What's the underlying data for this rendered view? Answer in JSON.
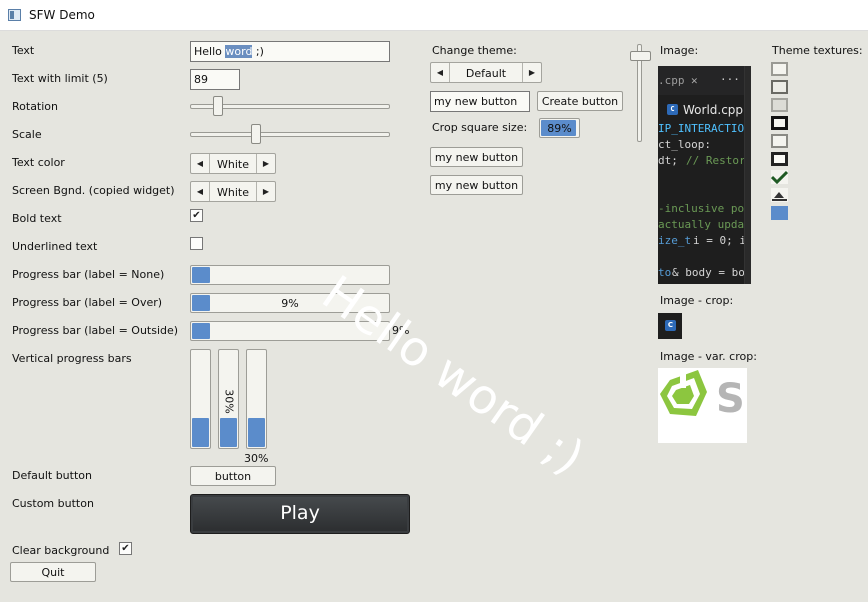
{
  "window": {
    "title": "SFW Demo"
  },
  "form": {
    "text": {
      "label": "Text",
      "value_before": "Hello ",
      "value_selected": "word",
      "value_after": " ;)"
    },
    "text_limit": {
      "label": "Text with limit (5)",
      "value": "89"
    },
    "rotation": {
      "label": "Rotation",
      "value": 0.12
    },
    "scale": {
      "label": "Scale",
      "value": 0.32
    },
    "text_color": {
      "label": "Text color",
      "value": "White"
    },
    "screen_bg": {
      "label": "Screen Bgnd. (copied widget)",
      "value": "White"
    },
    "bold": {
      "label": "Bold text",
      "checked": true
    },
    "underlined": {
      "label": "Underlined text",
      "checked": false
    },
    "pb_none": {
      "label": "Progress bar (label = None)",
      "value": 0.09
    },
    "pb_over": {
      "label": "Progress bar (label = Over)",
      "text": "9%",
      "value": 0.09
    },
    "pb_outside": {
      "label": "Progress bar (label = Outside)",
      "text": "9%",
      "value": 0.09
    },
    "vbars": {
      "label": "Vertical progress bars",
      "over_text": "30%",
      "outside_text": "30%",
      "value": 0.3
    },
    "default_button": {
      "label": "Default button",
      "text": "button"
    },
    "custom_button": {
      "label": "Custom button",
      "text": "Play"
    },
    "clear_bg": {
      "label": "Clear background",
      "checked": true
    },
    "quit": {
      "text": "Quit"
    }
  },
  "middle": {
    "change_theme": {
      "label": "Change theme:",
      "value": "Default"
    },
    "new_button_1": "my new button",
    "create_button": "Create button",
    "crop": {
      "label": "Crop square size:",
      "value": "89%",
      "fill": 0.89
    },
    "new_button_2": "my new button",
    "new_button_3": "my new button",
    "vslider_value": 0.9
  },
  "right": {
    "image_label": "Image:",
    "theme_textures_label": "Theme textures:",
    "crop_label": "Image - crop:",
    "var_crop_label": "Image - var. crop:",
    "code": {
      "tab_partial": ".cpp",
      "tab_close": "✕",
      "tab_more": "···",
      "file_tab": "World.cpp",
      "lines": [
        "IP_INTERACTION",
        "ct_loop:",
        "dt; ",
        "// Restore",
        "-inclusive pos",
        " actually upda",
        "ize_t",
        " i = 0; i",
        "to",
        "& body = bod"
      ]
    },
    "crop_badge": "C",
    "var_crop_letter": "S"
  },
  "overlay_text": "Hello word ;)",
  "colors": {
    "background": "#e5e5df",
    "progress": "#5b8ccb",
    "accent_green": "#6cbf2f",
    "code_bg": "#1e1e1e"
  }
}
